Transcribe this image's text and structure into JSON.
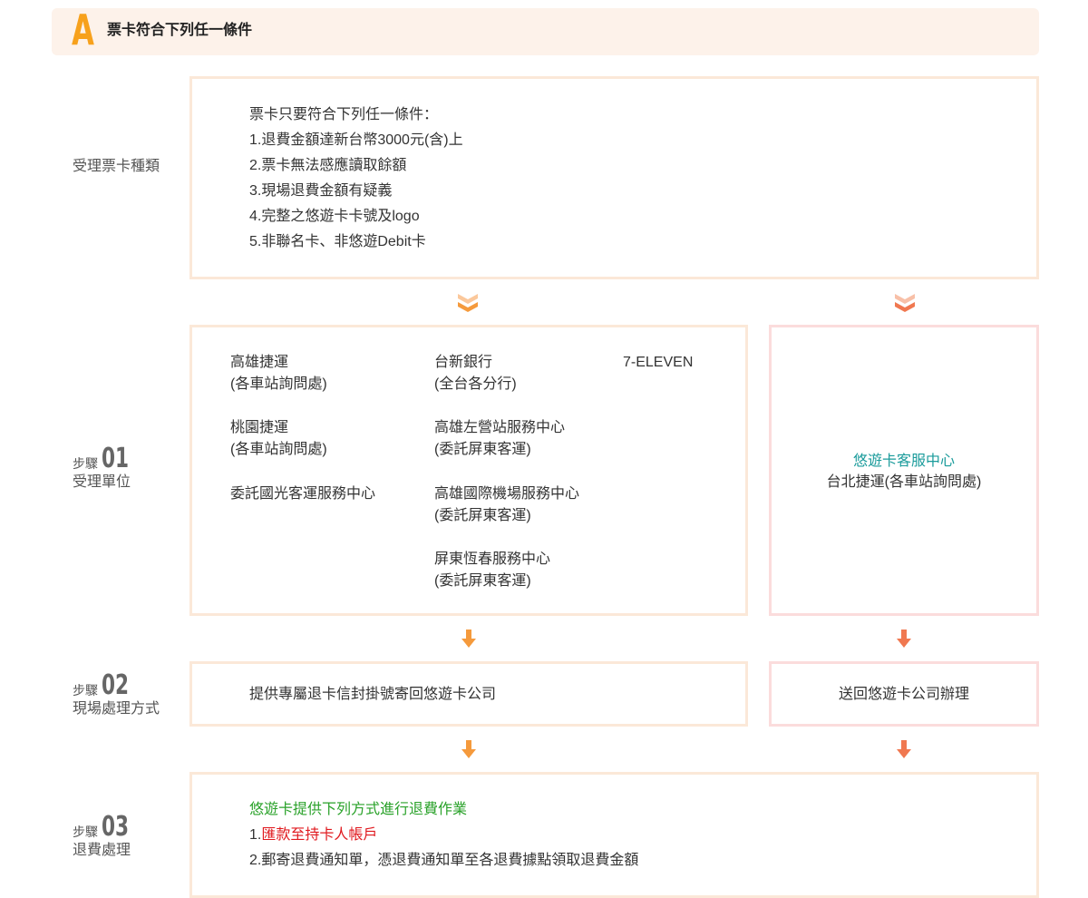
{
  "header": {
    "letter": "A",
    "title": "票卡符合下列任一條件"
  },
  "rows": {
    "eligibility": {
      "label": "受理票卡種類",
      "heading": "票卡只要符合下列任一條件：",
      "items": [
        "1.退費金額達新台幣3000元(含)上",
        "2.票卡無法感應讀取餘額",
        "3.現場退費金額有疑義",
        "4.完整之悠遊卡卡號及logo",
        "5.非聯名卡、非悠遊Debit卡"
      ]
    },
    "step1": {
      "word": "步驟",
      "num": "01",
      "label": "受理單位",
      "col1": [
        {
          "name": "高雄捷運",
          "sub": "(各車站詢問處)"
        },
        {
          "name": "桃園捷運",
          "sub": "(各車站詢問處)"
        },
        {
          "name": "委託國光客運服務中心",
          "sub": ""
        }
      ],
      "col2": [
        {
          "name": "台新銀行",
          "sub": "(全台各分行)"
        },
        {
          "name": "高雄左營站服務中心",
          "sub": "(委託屏東客運)"
        },
        {
          "name": "高雄國際機場服務中心",
          "sub": "(委託屏東客運)"
        },
        {
          "name": "屏東恆春服務中心",
          "sub": "(委託屏東客運)"
        }
      ],
      "col3": "7-ELEVEN",
      "right_title": "悠遊卡客服中心",
      "right_sub": "台北捷運(各車站詢問處)"
    },
    "step2": {
      "word": "步驟",
      "num": "02",
      "label": "現場處理方式",
      "left_text": "提供專屬退卡信封掛號寄回悠遊卡公司",
      "right_text": "送回悠遊卡公司辦理"
    },
    "step3": {
      "word": "步驟",
      "num": "03",
      "label": "退費處理",
      "heading": "悠遊卡提供下列方式進行退費作業",
      "item1_prefix": "1.",
      "item1_text": "匯款至持卡人帳戶",
      "item2": "2.郵寄退費通知單，憑退費通知單至各退費據點領取退費金額"
    }
  },
  "colors": {
    "accent_orange": "#f7a11c",
    "arrow_orange": "#f59a3c",
    "arrow_red": "#f07850",
    "border_orange": "#fbe8d8",
    "border_pink": "#fbdcdc",
    "teal": "#1a9b9b",
    "green": "#2aa22a",
    "red": "#e0191e"
  }
}
